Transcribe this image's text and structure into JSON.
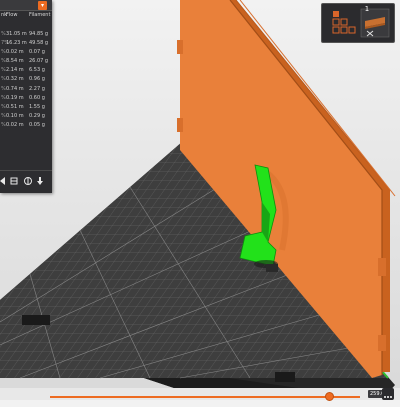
{
  "stats": {
    "headers": [
      "nk",
      "Flow",
      "Filament"
    ],
    "rows": [
      {
        "pct": "%",
        "length": "31.05 m",
        "weight": "94.85 g"
      },
      {
        "pct": "7%",
        "length": "16.23 m",
        "weight": "49.58 g"
      },
      {
        "pct": "%",
        "length": "0.02 m",
        "weight": "0.07 g"
      },
      {
        "pct": "%",
        "length": "8.54 m",
        "weight": "26.07 g"
      },
      {
        "pct": "%",
        "length": "2.14 m",
        "weight": "6.53 g"
      },
      {
        "pct": "%",
        "length": "0.32 m",
        "weight": "0.96 g"
      },
      {
        "pct": "%",
        "length": "0.74 m",
        "weight": "2.27 g"
      },
      {
        "pct": "%",
        "length": "0.19 m",
        "weight": "0.60 g"
      },
      {
        "pct": "%",
        "length": "0.51 m",
        "weight": "1.55 g"
      },
      {
        "pct": "%",
        "length": "0.10 m",
        "weight": "0.29 g"
      },
      {
        "pct": "%",
        "length": "0.02 m",
        "weight": "0.05 g"
      }
    ],
    "dropdown_glyph": "▾"
  },
  "toolbar": {
    "badge": "1",
    "icons": [
      "objects-grid-icon",
      "layers-view-icon"
    ]
  },
  "slider": {
    "layer_label": "259.60",
    "level": 0.9,
    "accent": "#ed6b21"
  },
  "colors": {
    "model_orange": "#e07833",
    "support_green": "#22e11a",
    "bed_dark": "#3c3c3c",
    "ui_dark": "#2d2d30"
  }
}
